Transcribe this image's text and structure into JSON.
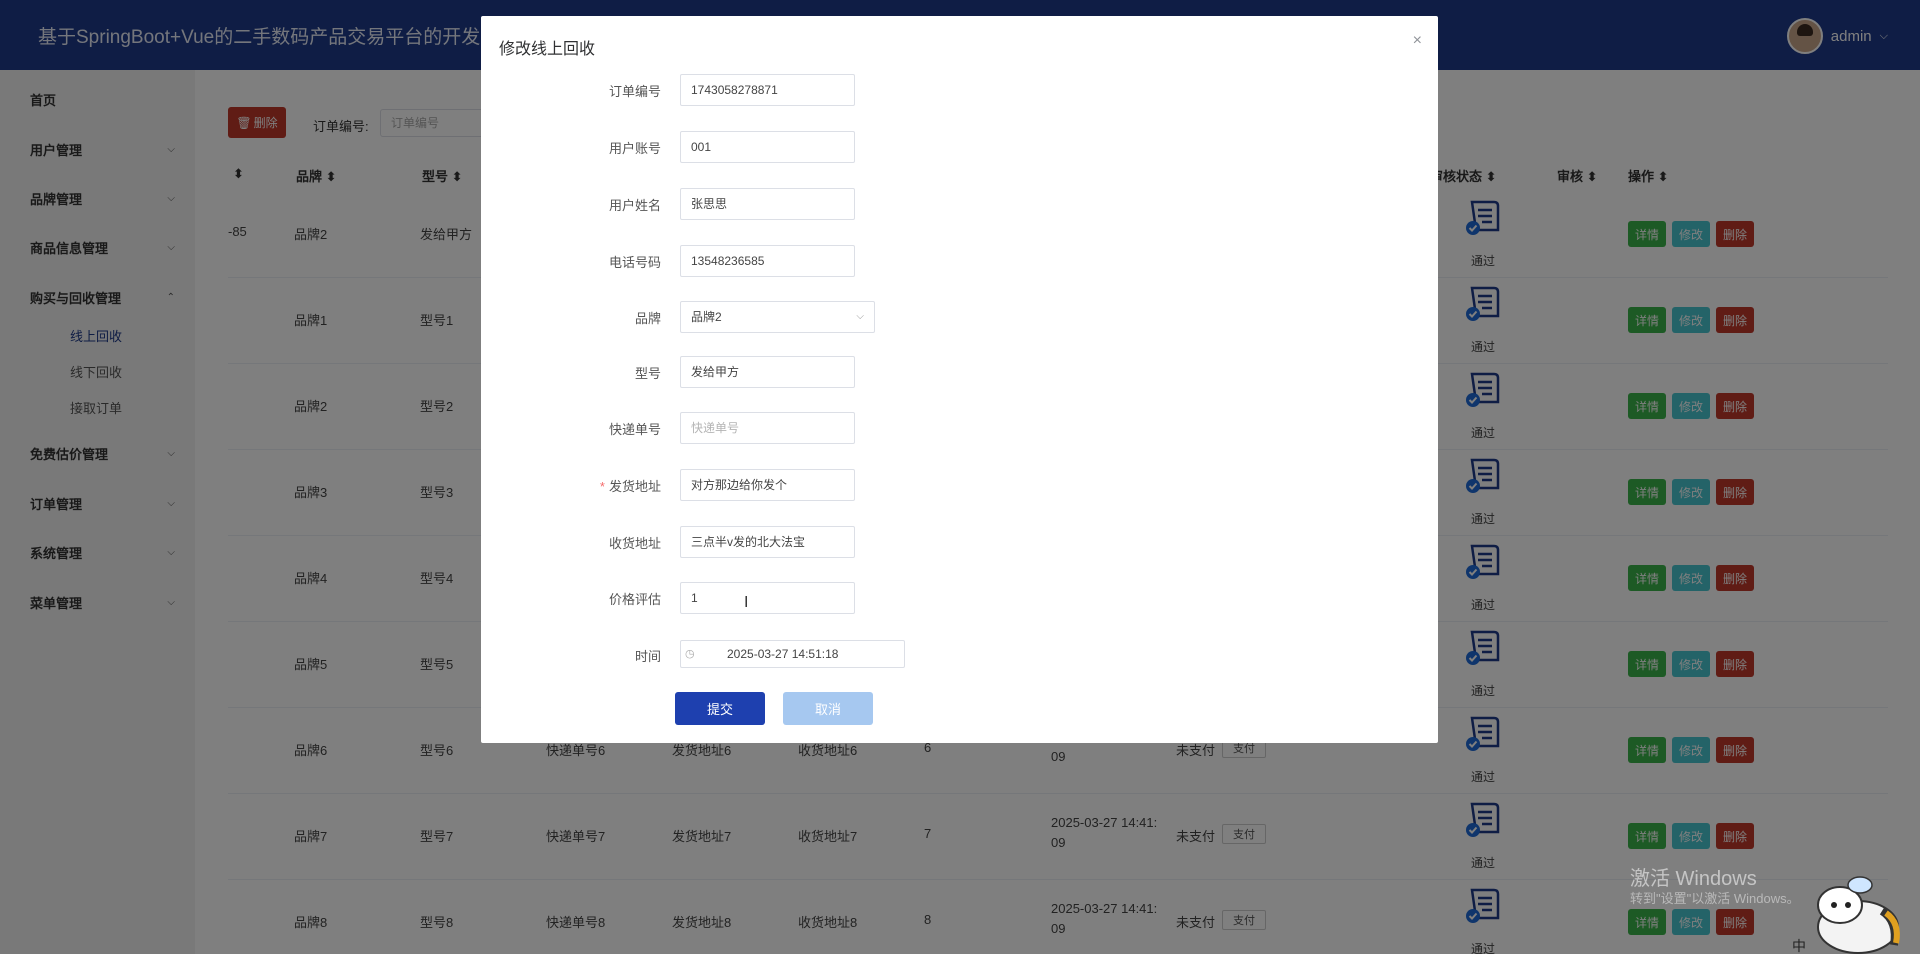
{
  "header": {
    "title": "基于SpringBoot+Vue的二手数码产品交易平台的开发",
    "username": "admin",
    "user_chevron": "⌵"
  },
  "sidebar": {
    "items": [
      {
        "label": "首页",
        "chevron": ""
      },
      {
        "label": "用户管理",
        "chevron": "⌵"
      },
      {
        "label": "品牌管理",
        "chevron": "⌵"
      },
      {
        "label": "商品信息管理",
        "chevron": "⌵"
      },
      {
        "label": "购买与回收管理",
        "chevron": "⌃"
      },
      {
        "label": "免费估价管理",
        "chevron": "⌵"
      },
      {
        "label": "订单管理",
        "chevron": "⌵"
      },
      {
        "label": "系统管理",
        "chevron": "⌵"
      },
      {
        "label": "菜单管理",
        "chevron": "⌵"
      }
    ],
    "sub_items": [
      {
        "label": "线上回收",
        "active": true
      },
      {
        "label": "线下回收",
        "active": false
      },
      {
        "label": "接取订单",
        "active": false
      }
    ]
  },
  "toolbar": {
    "delete_label": "删除",
    "filter_label": "订单编号:",
    "filter_placeholder": "订单编号"
  },
  "table": {
    "headers": {
      "col_partial": "⬍",
      "brand": "品牌 ⬍",
      "model": "型号 ⬍",
      "audit_status": "审核状态 ⬍",
      "audit": "审核 ⬍",
      "ops": "操作 ⬍"
    },
    "rows": [
      {
        "first": "-85",
        "brand": "品牌2",
        "model": "发给甲方",
        "tracking": "",
        "ship": "",
        "recv": "",
        "price": "",
        "time_a": "",
        "time_b": "",
        "pay_status": "",
        "pay_btn": "",
        "audit": "通过"
      },
      {
        "first": "",
        "brand": "品牌1",
        "model": "型号1",
        "tracking": "",
        "ship": "",
        "recv": "",
        "price": "",
        "time_a": "",
        "time_b": "",
        "pay_status": "",
        "pay_btn": "",
        "audit": "通过"
      },
      {
        "first": "",
        "brand": "品牌2",
        "model": "型号2",
        "tracking": "",
        "ship": "",
        "recv": "",
        "price": "",
        "time_a": "",
        "time_b": "",
        "pay_status": "",
        "pay_btn": "",
        "audit": "通过"
      },
      {
        "first": "",
        "brand": "品牌3",
        "model": "型号3",
        "tracking": "",
        "ship": "",
        "recv": "",
        "price": "",
        "time_a": "",
        "time_b": "",
        "pay_status": "",
        "pay_btn": "",
        "audit": "通过"
      },
      {
        "first": "",
        "brand": "品牌4",
        "model": "型号4",
        "tracking": "",
        "ship": "",
        "recv": "",
        "price": "",
        "time_a": "",
        "time_b": "",
        "pay_status": "",
        "pay_btn": "",
        "audit": "通过"
      },
      {
        "first": "",
        "brand": "品牌5",
        "model": "型号5",
        "tracking": "",
        "ship": "",
        "recv": "",
        "price": "",
        "time_a": "",
        "time_b": "",
        "pay_status": "",
        "pay_btn": "",
        "audit": "通过"
      },
      {
        "first": "",
        "brand": "品牌6",
        "model": "型号6",
        "tracking": "快递单号6",
        "ship": "发货地址6",
        "recv": "收货地址6",
        "price": "6",
        "time_a": "",
        "time_b": "09",
        "pay_status": "未支付",
        "pay_btn": "支付",
        "audit": "通过"
      },
      {
        "first": "",
        "brand": "品牌7",
        "model": "型号7",
        "tracking": "快递单号7",
        "ship": "发货地址7",
        "recv": "收货地址7",
        "price": "7",
        "time_a": "2025-03-27 14:41:",
        "time_b": "09",
        "pay_status": "未支付",
        "pay_btn": "支付",
        "audit": "通过"
      },
      {
        "first": "",
        "brand": "品牌8",
        "model": "型号8",
        "tracking": "快递单号8",
        "ship": "发货地址8",
        "recv": "收货地址8",
        "price": "8",
        "time_a": "2025-03-27 14:41:",
        "time_b": "09",
        "pay_status": "未支付",
        "pay_btn": "支付",
        "audit": "通过"
      }
    ],
    "op_labels": {
      "detail": "详情",
      "edit": "修改",
      "delete": "删除"
    }
  },
  "dialog": {
    "title": "修改线上回收",
    "close": "×",
    "fields": [
      {
        "label": "订单编号",
        "value": "1743058278871",
        "required": false
      },
      {
        "label": "用户账号",
        "value": "001",
        "required": false
      },
      {
        "label": "用户姓名",
        "value": "张思思",
        "required": false
      },
      {
        "label": "电话号码",
        "value": "13548236585",
        "required": false
      },
      {
        "label": "品牌",
        "value": "品牌2",
        "required": false
      },
      {
        "label": "型号",
        "value": "发给甲方",
        "required": false
      },
      {
        "label": "快递单号",
        "value": "",
        "placeholder": "快递单号",
        "required": false
      },
      {
        "label": "发货地址",
        "value": "对方那边给你发个",
        "required": true
      },
      {
        "label": "收货地址",
        "value": "三点半v发的北大法宝",
        "required": false
      },
      {
        "label": "价格评估",
        "value": "1",
        "required": false
      },
      {
        "label": "时间",
        "value": "2025-03-27 14:51:18",
        "required": false
      }
    ],
    "required_mark": "*",
    "select_arrow": "⌵",
    "clock_glyph": "◷",
    "submit_label": "提交",
    "cancel_label": "取消"
  },
  "watermark": {
    "title": "激活 Windows",
    "subtitle": "转到\"设置\"以激活 Windows。"
  },
  "colors": {
    "header_bg": "#1e3a8a",
    "primary": "#1e40af",
    "danger": "#c0392b",
    "success": "#3bb54a",
    "info": "#49c6d0"
  }
}
